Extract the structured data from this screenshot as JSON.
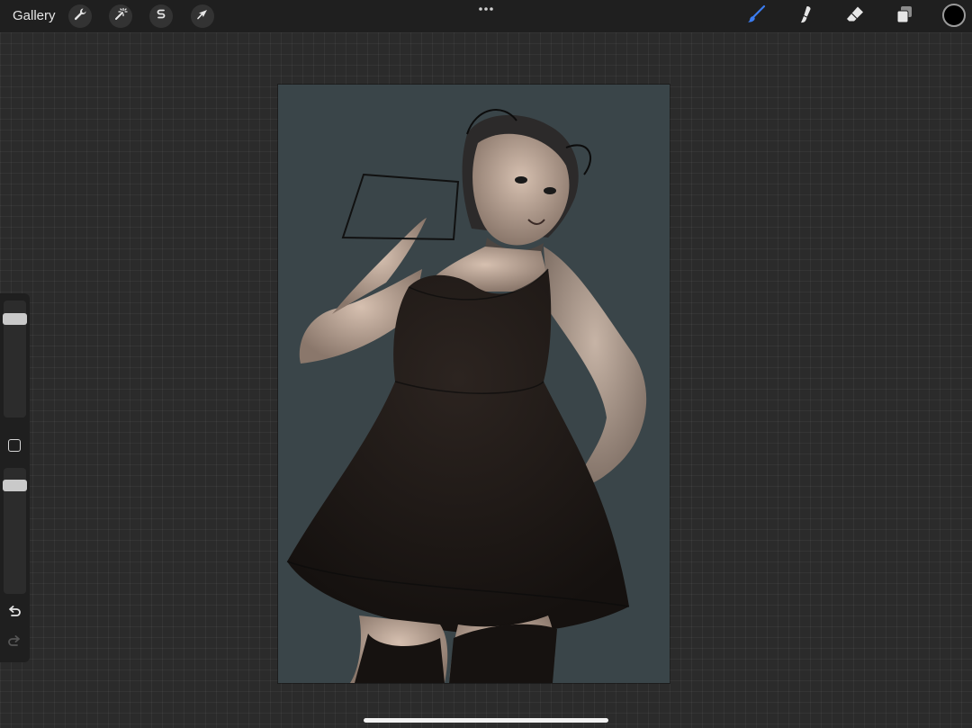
{
  "toolbar": {
    "gallery_label": "Gallery",
    "left_tools": [
      {
        "icon": "wrench-icon",
        "name": "actions"
      },
      {
        "icon": "magic-wand-icon",
        "name": "adjustments"
      },
      {
        "icon": "selection-s-icon",
        "name": "selection"
      },
      {
        "icon": "arrow-cursor-icon",
        "name": "transform"
      }
    ],
    "more_icon": "more-dots-icon",
    "right_tools": [
      {
        "icon": "brush-icon",
        "name": "paint",
        "active": true,
        "color": "#3b7cf0"
      },
      {
        "icon": "smudge-icon",
        "name": "smudge",
        "active": false,
        "color": "#e6e6e6"
      },
      {
        "icon": "eraser-icon",
        "name": "erase",
        "active": false,
        "color": "#e6e6e6"
      },
      {
        "icon": "layers-icon",
        "name": "layers",
        "active": false,
        "color": "#e6e6e6"
      }
    ],
    "current_color": "#000000"
  },
  "sidebar": {
    "brush_size_level": 0.88,
    "opacity_level": 0.9,
    "modify_icon": "square-modify-icon",
    "undo_icon": "undo-icon",
    "redo_icon": "redo-icon",
    "redo_enabled": false
  },
  "canvas": {
    "background_color": "#3a4549",
    "artwork": "sketch-illustration"
  },
  "colors": {
    "app_background": "#2b2b2b",
    "toolbar_background": "#1f1f1f",
    "accent": "#3b7cf0"
  }
}
